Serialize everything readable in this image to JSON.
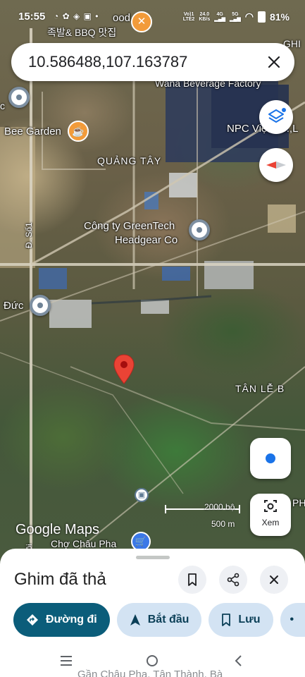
{
  "status_bar": {
    "time": "15:55",
    "left_icons": "◔ ✿ ◈ ▣ •",
    "network_top": "Vo)1",
    "network_bottom": "LTE2",
    "speed_top": "24.0",
    "speed_bottom": "KB/s",
    "signal_type": "4G",
    "signal_type2": "5G",
    "battery": "81%"
  },
  "search": {
    "coordinates": "10.586488,107.163787"
  },
  "map": {
    "labels": {
      "restaurant_partial": "ood",
      "restaurant_korean": "족발& BBQ 맛집",
      "beverage_factory": "Wana Beverage Factory",
      "top_right_partial": "GHI",
      "left_partial_c": "c",
      "bee_garden": "Bee Garden",
      "npc": "NPC Việt Co.,L",
      "quang_tay": "QUẢNG TÂY",
      "greentech_1": "Công ty GreenTech",
      "greentech_2": "Headgear Co",
      "road": "Đ. Số1",
      "duc": "Đức",
      "tan_le_b": "TÂN LỄ B",
      "right_edge_partial": "PH",
      "google_maps": "Google Maps",
      "cho_chau_pha": "Chợ Châu Pha",
      "scale_ft": "2000 bộ",
      "scale_m": "500 m",
      "bottom_left_edge": "ôi"
    },
    "buttons": {
      "layers": "layers-icon",
      "compass": "compass-icon",
      "my_location": "my-location-icon",
      "view_label": "Xem"
    },
    "colors": {
      "pin_red": "#ea4335",
      "restaurant_orange": "#f29b3a",
      "location_blue": "#3367d6"
    }
  },
  "sheet": {
    "title": "Ghim đã thả",
    "chips": {
      "directions": "Đường đi",
      "start": "Bắt đầu",
      "save": "Lưu"
    },
    "address_peek": "Gần Châu Pha, Tân Thành, Bà"
  }
}
